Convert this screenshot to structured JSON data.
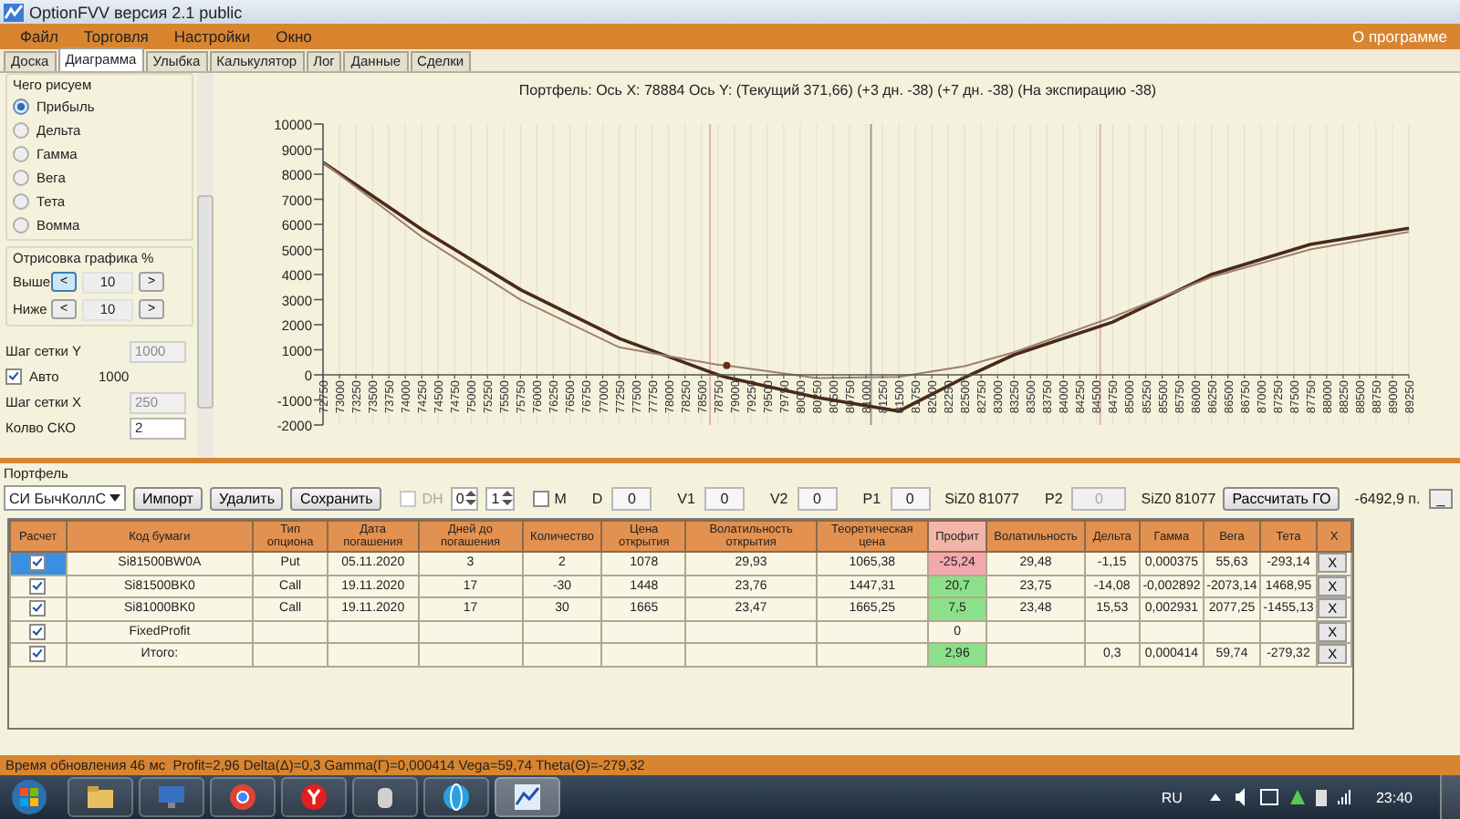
{
  "window": {
    "title": "OptionFVV версия 2.1 public"
  },
  "menu": [
    {
      "label": "Файл"
    },
    {
      "label": "Торговля"
    },
    {
      "label": "Настройки"
    },
    {
      "label": "Окно"
    }
  ],
  "menu_right": "О программе",
  "tabs": [
    {
      "label": "Доска",
      "selected": false
    },
    {
      "label": "Диаграмма",
      "selected": true
    },
    {
      "label": "Улыбка",
      "selected": false
    },
    {
      "label": "Калькулятор",
      "selected": false
    },
    {
      "label": "Лог",
      "selected": false
    },
    {
      "label": "Данные",
      "selected": false
    },
    {
      "label": "Сделки",
      "selected": false
    }
  ],
  "draw_panel": {
    "title": "Чего рисуем",
    "options": [
      {
        "label": "Прибыль",
        "selected": true
      },
      {
        "label": "Дельта",
        "selected": false
      },
      {
        "label": "Гамма",
        "selected": false
      },
      {
        "label": "Вега",
        "selected": false
      },
      {
        "label": "Тета",
        "selected": false
      },
      {
        "label": "Вомма",
        "selected": false
      }
    ]
  },
  "range_panel": {
    "title": "Отрисовка графика %",
    "rows": [
      {
        "label": "Выше",
        "dec": "<",
        "value": "10",
        "inc": ">",
        "focused": true
      },
      {
        "label": "Ниже",
        "dec": "<",
        "value": "10",
        "inc": ">",
        "focused": false
      }
    ]
  },
  "grid_settings": [
    {
      "kind": "field",
      "label": "Шаг сетки Y",
      "value": "1000",
      "disabled": true
    },
    {
      "kind": "check",
      "label": "Авто",
      "checked": true,
      "value": "1000"
    },
    {
      "kind": "field",
      "label": "Шаг сетки X",
      "value": "250",
      "disabled": true
    },
    {
      "kind": "field",
      "label": "Колво СКО",
      "value": "2",
      "disabled": false
    }
  ],
  "chart": {
    "chart_data": {
      "type": "line",
      "title": "Портфель: Ось X: 78884 Ось Y:  (Текущий 371,66)  (+3 дн. -38)  (+7 дн. -38)  (На экспирацию -38)",
      "x": [
        72750,
        74250,
        75750,
        77250,
        78750,
        78884,
        80250,
        81500,
        82500,
        83250,
        84750,
        86250,
        87750,
        89250
      ],
      "series": [
        {
          "color": "#4a2a1a",
          "values": [
            8470,
            5800,
            3400,
            1450,
            0,
            -100,
            -900,
            -1450,
            -100,
            800,
            2100,
            4000,
            5200,
            5850
          ]
        },
        {
          "color": "#a08070",
          "values": [
            8470,
            5500,
            3000,
            1100,
            400,
            370,
            -130,
            -80,
            350,
            900,
            2300,
            3900,
            5000,
            5700
          ]
        },
        {
          "color": "#6a2a1a",
          "marker": true,
          "values": [
            null,
            null,
            null,
            null,
            null,
            370,
            null,
            null,
            null,
            null,
            null,
            null,
            null,
            null
          ]
        }
      ],
      "grid": true,
      "xlim": [
        72750,
        89250
      ],
      "ylim": [
        -2000,
        10000
      ],
      "xticks": [
        72750,
        73000,
        73250,
        73500,
        73750,
        74000,
        74250,
        74500,
        74750,
        75000,
        75250,
        75500,
        75750,
        76000,
        76250,
        76500,
        76750,
        77000,
        77250,
        77500,
        77750,
        78000,
        78250,
        78500,
        78750,
        79000,
        79250,
        79500,
        79750,
        80000,
        80250,
        80500,
        80750,
        81000,
        81250,
        81500,
        81750,
        82000,
        82250,
        82500,
        82750,
        83000,
        83250,
        83500,
        83750,
        84000,
        84250,
        84500,
        84750,
        85000,
        85250,
        85500,
        85750,
        86000,
        86250,
        86500,
        86750,
        87000,
        87250,
        87500,
        87750,
        88000,
        88250,
        88500,
        88750,
        89000,
        89250
      ],
      "yticks": [
        -2000,
        -1000,
        0,
        1000,
        2000,
        3000,
        4000,
        5000,
        6000,
        7000,
        8000,
        9000,
        10000
      ],
      "ref_lines": [
        {
          "axis": "x",
          "value": 78630,
          "color": "#e8b0b0"
        },
        {
          "axis": "x",
          "value": 81077,
          "color": "#9a9a9a"
        },
        {
          "axis": "x",
          "value": 84560,
          "color": "#e8b0b0"
        }
      ]
    }
  },
  "portfolio": {
    "title": "Портфель",
    "toolbar": [
      {
        "kind": "select",
        "value": "СИ БычКоллС"
      },
      {
        "kind": "button",
        "label": "Импорт"
      },
      {
        "kind": "button",
        "label": "Удалить"
      },
      {
        "kind": "button",
        "label": "Сохранить"
      },
      {
        "kind": "check",
        "label": "DH",
        "checked": false,
        "disabled": true
      },
      {
        "kind": "spin",
        "value": "0"
      },
      {
        "kind": "spin",
        "value": "1"
      },
      {
        "kind": "check",
        "label": "M",
        "checked": false,
        "disabled": false
      },
      {
        "kind": "field",
        "label": "D",
        "value": "0",
        "disabled": false
      },
      {
        "kind": "field",
        "label": "V1",
        "value": "0",
        "disabled": false
      },
      {
        "kind": "field",
        "label": "V2",
        "value": "0",
        "disabled": false
      },
      {
        "kind": "field",
        "label": "P1",
        "value": "0",
        "disabled": false
      },
      {
        "kind": "text",
        "label": "SiZ0 81077"
      },
      {
        "kind": "field",
        "label": "P2",
        "value": "0",
        "disabled": true
      },
      {
        "kind": "text",
        "label": "SiZ0 81077"
      },
      {
        "kind": "button",
        "label": "Рассчитать ГО"
      },
      {
        "kind": "text",
        "label": "-6492,9 п."
      }
    ],
    "minimize": "_",
    "table": {
      "columns": [
        "Расчет",
        "Код бумаги",
        "Тип опциона",
        "Дата погашения",
        "Дней до погашения",
        "Количество",
        "Цена открытия",
        "Волатильность открытия",
        "Теоретическая цена",
        "Профит",
        "Волатильность",
        "Дельта",
        "Гамма",
        "Вега",
        "Тета",
        "X"
      ],
      "rows": [
        {
          "selected": true,
          "checked": true,
          "color": "#f5a7b0",
          "cells": [
            "",
            "Si81500BW0A",
            "Put",
            "05.11.2020",
            "3",
            "2",
            "1078",
            "29,93",
            "1065,38",
            "-25,24",
            "29,48",
            "-1,15",
            "0,000375",
            "55,63",
            "-293,14"
          ],
          "delete": "X"
        },
        {
          "selected": false,
          "checked": true,
          "color": "#8ce08a",
          "cells": [
            "",
            "Si81500BK0",
            "Call",
            "19.11.2020",
            "17",
            "-30",
            "1448",
            "23,76",
            "1447,31",
            "20,7",
            "23,75",
            "-14,08",
            "-0,002892",
            "-2073,14",
            "1468,95"
          ],
          "delete": "X"
        },
        {
          "selected": false,
          "checked": true,
          "color": "#8ce08a",
          "cells": [
            "",
            "Si81000BK0",
            "Call",
            "19.11.2020",
            "17",
            "30",
            "1665",
            "23,47",
            "1665,25",
            "7,5",
            "23,48",
            "15,53",
            "0,002931",
            "2077,25",
            "-1455,13"
          ],
          "delete": "X"
        },
        {
          "selected": false,
          "checked": true,
          "cells": [
            "",
            "FixedProfit",
            "",
            "",
            "",
            "",
            "",
            "",
            "",
            "0",
            "",
            "",
            "",
            "",
            ""
          ],
          "delete": "X"
        },
        {
          "selected": false,
          "checked": true,
          "color": "#8ce08a",
          "cells": [
            "",
            "Итого:",
            "",
            "",
            "",
            "",
            "",
            "",
            "",
            "2,96",
            "",
            "0,3",
            "0,000414",
            "59,74",
            "-279,32"
          ],
          "delete": "X"
        }
      ]
    }
  },
  "status_bar": "Время обновления 46 мс  Profit=2,96 Delta(Δ)=0,3 Gamma(Γ)=0,000414 Vega=59,74 Theta(Θ)=-279,32",
  "taskbar": {
    "language": "RU",
    "clock": "23:40"
  }
}
